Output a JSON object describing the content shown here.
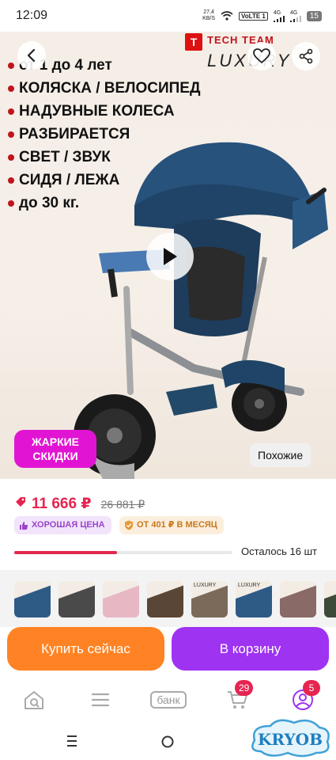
{
  "status_bar": {
    "time": "12:09",
    "speed_value": "27,4",
    "speed_unit": "KB/S",
    "volte": "VoLTE 1",
    "net1": "4G",
    "net2": "4G",
    "battery": "15"
  },
  "hero": {
    "features": [
      "от 1 до 4 лет",
      "КОЛЯСКА / ВЕЛОСИПЕД",
      "НАДУВНЫЕ КОЛЕСА",
      "РАЗБИРАЕТСЯ",
      "СВЕТ / ЗВУК",
      "СИДЯ / ЛЕЖА",
      "до 30 кг."
    ],
    "brand_top": "TECH TEAM",
    "brand_bottom": "LUXURY",
    "hot_badge": "ЖАРКИЕ СКИДКИ",
    "similar_label": "Похожие",
    "icons": {
      "back": "chevron-left-icon",
      "favorite": "heart-icon",
      "share": "share-icon",
      "play": "play-icon"
    }
  },
  "info": {
    "price": "11 666 ₽",
    "old_price": "26 881 ₽",
    "good_price": "ХОРОШАЯ ЦЕНА",
    "monthly": "ОТ 401 ₽ В МЕСЯЦ",
    "remaining": "Осталось 16 шт",
    "stock_progress": 0.47,
    "accent_color": "#e6244f"
  },
  "thumbnails": {
    "count": 9,
    "colors": [
      "#2e5a86",
      "#4a4a4a",
      "#e8b7c4",
      "#5a4636",
      "#7b6a5a",
      "#2e5a86",
      "#8a6a66",
      "#3d4a3a",
      "#556b8a"
    ],
    "labels": [
      "",
      "",
      "",
      "",
      "LUXURY",
      "LUXURY",
      "",
      "",
      ""
    ]
  },
  "actions": {
    "buy_now": "Купить сейчас",
    "add_to_cart": "В корзину",
    "buy_color": "#ff8324",
    "cart_color": "#9e33f2"
  },
  "bottom_nav": {
    "bank_label": "банк",
    "cart_badge": "29",
    "profile_badge": "5",
    "items": [
      "home-icon",
      "catalog-icon",
      "bank-icon",
      "cart-icon",
      "profile-icon"
    ]
  },
  "watermark": {
    "text": "KRYOB"
  }
}
